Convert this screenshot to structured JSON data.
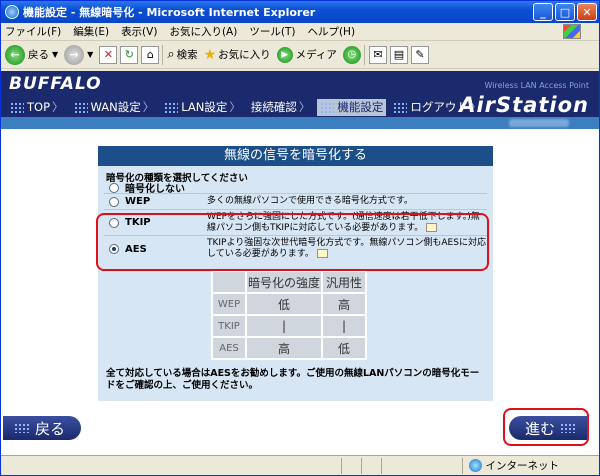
{
  "window": {
    "title": "機能設定 - 無線暗号化 - Microsoft Internet Explorer"
  },
  "menu": [
    "ファイル(F)",
    "編集(E)",
    "表示(V)",
    "お気に入り(A)",
    "ツール(T)",
    "ヘルプ(H)"
  ],
  "toolbar": {
    "back": "戻る",
    "search": "検索",
    "favorites": "お気に入り",
    "media": "メディア"
  },
  "brand": {
    "logo": "BUFFALO",
    "subtitle": "Wireless LAN Access Point",
    "product": "AirStation"
  },
  "nav": [
    {
      "label": "TOP",
      "active": false
    },
    {
      "label": "WAN設定",
      "active": false
    },
    {
      "label": "LAN設定",
      "active": false
    },
    {
      "label": "接続確認",
      "active": false
    },
    {
      "label": "機能設定",
      "active": true
    },
    {
      "label": "ログアウト",
      "active": false
    }
  ],
  "panel": {
    "title": "無線の信号を暗号化する",
    "instruction": "暗号化の種類を選択してください",
    "options": [
      {
        "name": "暗号化しない",
        "desc": "",
        "selected": false
      },
      {
        "name": "WEP",
        "desc": "多くの無線パソコンで使用できる暗号化方式です。",
        "selected": false
      },
      {
        "name": "TKIP",
        "desc": "WEPをさらに強固にした方式です。(通信速度は若干低下します。)無線パソコン側もTKIPに対応している必要があります。",
        "selected": false
      },
      {
        "name": "AES",
        "desc": "TKIPより強固な次世代暗号化方式です。無線パソコン側もAESに対応している必要があります。",
        "selected": true
      }
    ],
    "table": {
      "headers": [
        "暗号化の強度",
        "汎用性"
      ],
      "rows": [
        {
          "label": "WEP",
          "cells": [
            "低",
            "高"
          ]
        },
        {
          "label": "TKIP",
          "cells": [
            "|",
            "|"
          ]
        },
        {
          "label": "AES",
          "cells": [
            "高",
            "低"
          ]
        }
      ]
    },
    "footer": "全て対応している場合はAESをお勧めします。ご使用の無線LANパソコンの暗号化モードをご確認の上、ご使用ください。"
  },
  "buttons": {
    "back": "戻る",
    "next": "進む"
  },
  "status": {
    "zone": "インターネット"
  }
}
